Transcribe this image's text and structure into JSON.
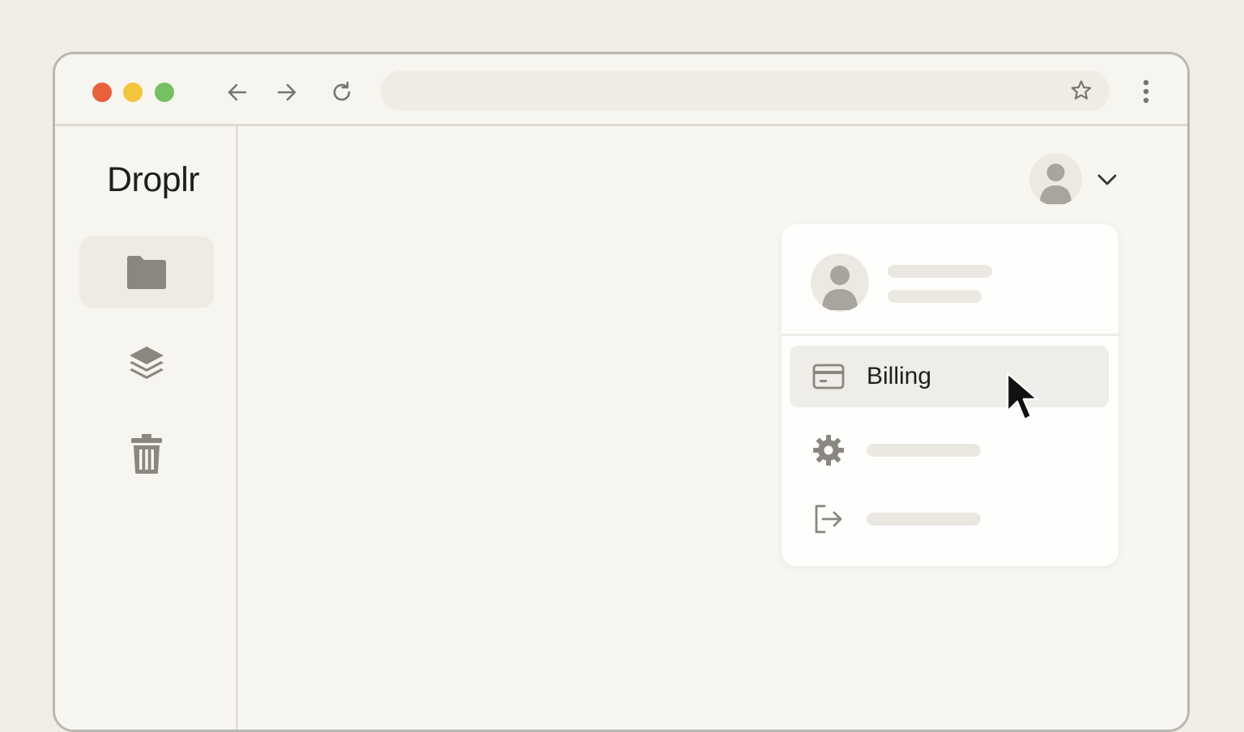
{
  "browser": {
    "window_controls": [
      "close",
      "minimize",
      "maximize"
    ],
    "nav_icons": [
      "arrow-left-icon",
      "arrow-right-icon",
      "reload-icon"
    ],
    "address_bar": {
      "value": "",
      "icon": "star-icon"
    },
    "menu_icon": "kebab-menu-icon"
  },
  "sidebar": {
    "logo": "Droplr",
    "items": [
      {
        "icon": "folder-icon",
        "active": true
      },
      {
        "icon": "layers-icon",
        "active": false
      },
      {
        "icon": "trash-icon",
        "active": false
      }
    ]
  },
  "account_menu": {
    "avatar_icon": "user-avatar-icon",
    "caret_icon": "chevron-down-icon",
    "items": [
      {
        "icon": "credit-card-icon",
        "label": "Billing",
        "hovered": true
      },
      {
        "icon": "gear-icon",
        "label": ""
      },
      {
        "icon": "logout-icon",
        "label": ""
      }
    ]
  },
  "colors": {
    "background": "#f1eee5",
    "window": "#f8f6f1",
    "icon_gray": "#8a8680",
    "close": "#e8603c",
    "minimize": "#f3c43e",
    "maximize": "#76bf63"
  }
}
